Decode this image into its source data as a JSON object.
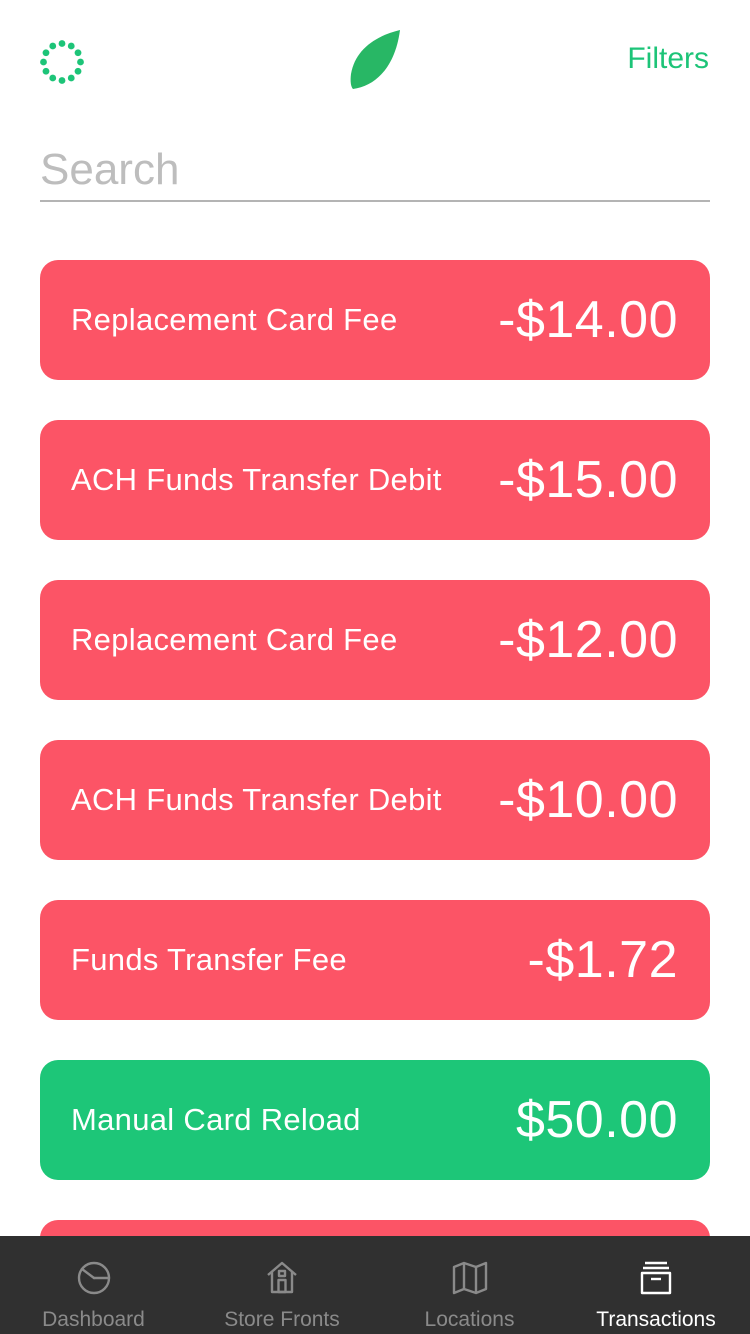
{
  "colors": {
    "accent": "#1dc478",
    "debit": "#fc5466",
    "credit": "#1dc678",
    "tabbar_bg": "#303030",
    "tab_inactive": "#8a8a8a",
    "tab_active": "#ffffff"
  },
  "header": {
    "left_icon": "loading-spinner-icon",
    "logo_icon": "leaf-logo-icon",
    "filters_label": "Filters"
  },
  "search": {
    "placeholder": "Search",
    "value": ""
  },
  "transactions": [
    {
      "name": "Replacement Card Fee",
      "amount": "-$14.00",
      "type": "debit"
    },
    {
      "name": "ACH Funds Transfer Debit",
      "amount": "-$15.00",
      "type": "debit"
    },
    {
      "name": "Replacement Card Fee",
      "amount": "-$12.00",
      "type": "debit"
    },
    {
      "name": "ACH Funds Transfer Debit",
      "amount": "-$10.00",
      "type": "debit"
    },
    {
      "name": "Funds Transfer Fee",
      "amount": "-$1.72",
      "type": "debit"
    },
    {
      "name": "Manual Card Reload",
      "amount": "$50.00",
      "type": "credit"
    },
    {
      "name": "",
      "amount": "",
      "type": "debit"
    }
  ],
  "tabs": [
    {
      "label": "Dashboard",
      "icon": "pie-chart-icon",
      "active": false
    },
    {
      "label": "Store Fronts",
      "icon": "storefront-icon",
      "active": false
    },
    {
      "label": "Locations",
      "icon": "map-icon",
      "active": false
    },
    {
      "label": "Transactions",
      "icon": "archive-box-icon",
      "active": true
    }
  ]
}
